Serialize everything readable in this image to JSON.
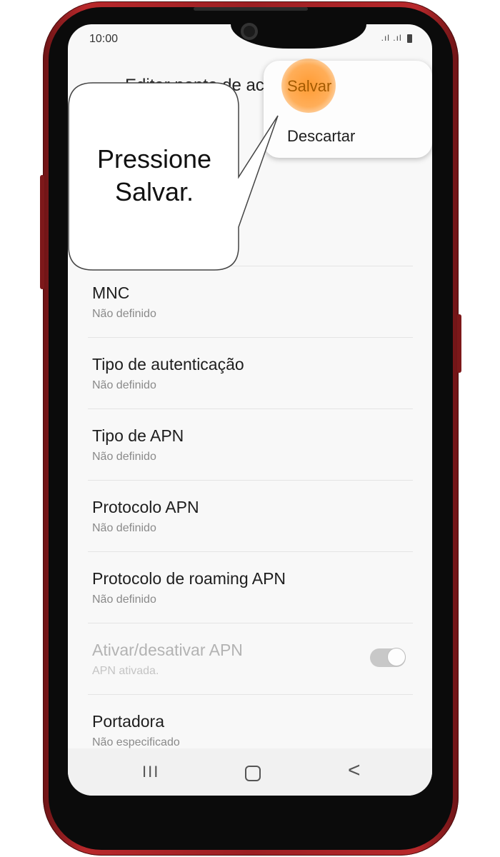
{
  "status_bar": {
    "time": "10:00",
    "signal_icons": ".ıl .ıl"
  },
  "app_bar": {
    "back_icon": "back-arrow-icon",
    "title": "Editar ponto de acesso"
  },
  "menu": {
    "save_label": "Salvar",
    "discard_label": "Descartar",
    "highlight_color": "#ff9a30"
  },
  "callout": {
    "line1": "Pressione",
    "line2": "Salvar."
  },
  "settings": [
    {
      "title": "MNC",
      "subtitle": "Não definido"
    },
    {
      "title": "Tipo de autenticação",
      "subtitle": "Não definido"
    },
    {
      "title": "Tipo de APN",
      "subtitle": "Não definido"
    },
    {
      "title": "Protocolo APN",
      "subtitle": "Não definido"
    },
    {
      "title": "Protocolo de roaming APN",
      "subtitle": "Não definido"
    },
    {
      "title": "Ativar/desativar APN",
      "subtitle": "APN ativada.",
      "toggle_on": true
    },
    {
      "title": "Portadora",
      "subtitle": "Não especificado"
    }
  ],
  "nav_bar": {
    "recents_glyph": "III",
    "back_glyph": "<"
  },
  "colors": {
    "phone_body": "#9c2023",
    "screen_bg": "#f8f8f8",
    "accent": "#ff9a30"
  }
}
